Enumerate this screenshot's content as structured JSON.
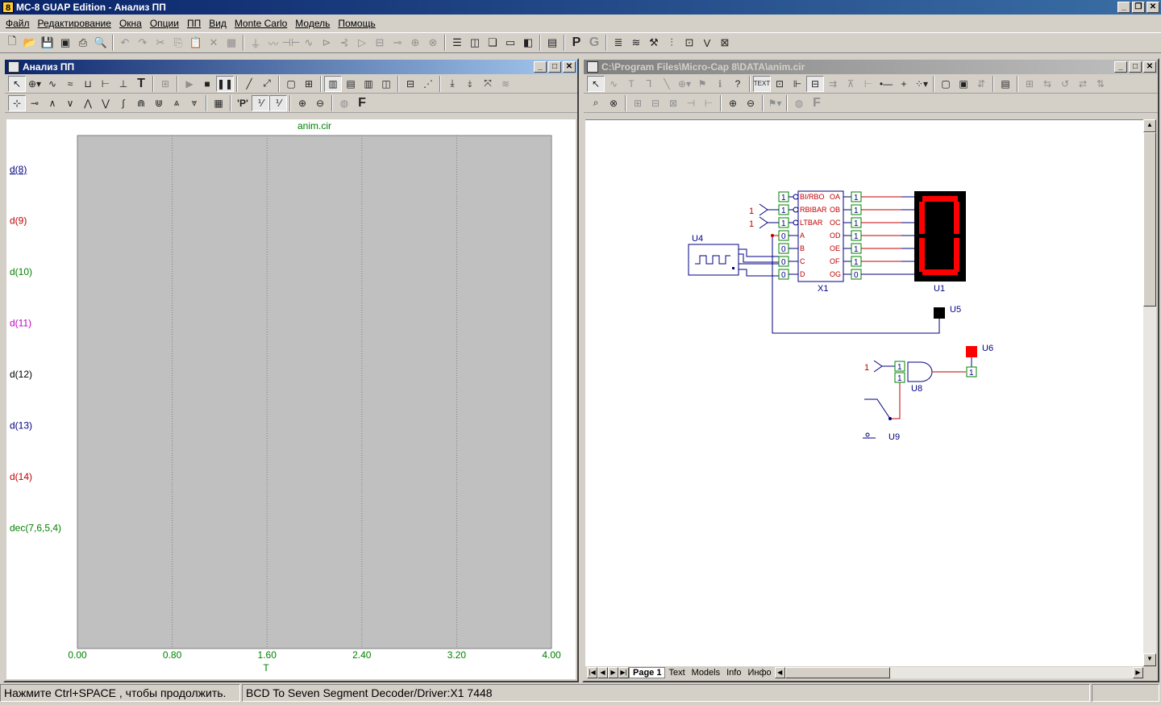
{
  "app": {
    "title": "MC-8 GUAP Edition - Анализ ПП"
  },
  "menu": [
    "Файл",
    "Редактирование",
    "Окна",
    "Опции",
    "ПП",
    "Вид",
    "Monte Carlo",
    "Модель",
    "Помощь"
  ],
  "analysis_window": {
    "title": "Анализ ПП",
    "plot_title": "anim.cir",
    "x_label": "T",
    "x_ticks": [
      "0.00",
      "0.80",
      "1.60",
      "2.40",
      "3.20",
      "4.00"
    ],
    "traces": [
      {
        "label": "d(8)",
        "color": "#000080"
      },
      {
        "label": "d(9)",
        "color": "#c00000"
      },
      {
        "label": "d(10)",
        "color": "#008000"
      },
      {
        "label": "d(11)",
        "color": "#c000c0"
      },
      {
        "label": "d(12)",
        "color": "#000000"
      },
      {
        "label": "d(13)",
        "color": "#000080"
      },
      {
        "label": "d(14)",
        "color": "#c00000"
      },
      {
        "label": "dec(7,6,5,4)",
        "color": "#008000"
      }
    ]
  },
  "schematic_window": {
    "title": "C:\\Program Files\\Micro-Cap 8\\DATA\\anim.cir",
    "tabs": [
      "Page 1",
      "Text",
      "Models",
      "Info",
      "Инфо"
    ],
    "labels": {
      "u4": "U4",
      "u1": "U1",
      "u5": "U5",
      "u6": "U6",
      "u8": "U8",
      "u9": "U9",
      "x1": "X1",
      "pin_bi": "BI/RBO",
      "pin_rbi": "RBIBAR",
      "pin_lt": "LTBAR",
      "pin_a": "A",
      "pin_b": "B",
      "pin_c": "C",
      "pin_d": "D",
      "out_a": "OA",
      "out_b": "OB",
      "out_c": "OC",
      "out_d": "OD",
      "out_e": "OE",
      "out_f": "OF",
      "out_g": "OG",
      "one": "1",
      "zero": "0"
    },
    "state": {
      "inputs_left": [
        "1",
        "1",
        "1",
        "0",
        "0",
        "0",
        "0"
      ],
      "outputs_right": [
        "1",
        "1",
        "1",
        "1",
        "1",
        "1",
        "0"
      ],
      "and_in": [
        "1",
        "1"
      ],
      "and_out": "1",
      "src_rbi": "1",
      "src_lt": "1",
      "src_and": "1"
    }
  },
  "status": {
    "left": "Нажмите Ctrl+SPACE , чтобы продолжить.",
    "right": "BCD To Seven Segment Decoder/Driver:X1 7448"
  },
  "colors": {
    "plot_bg": "#c0c0c0",
    "grid": "#808080",
    "axis_text": "#008000",
    "wire": "#000080",
    "pin": "#c00000",
    "state_box": "#008000",
    "segment_on": "#ff0000",
    "probe_red": "#ff0000"
  }
}
